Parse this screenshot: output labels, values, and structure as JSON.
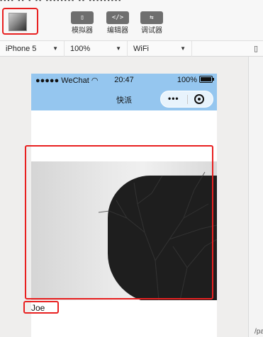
{
  "toolbar": {
    "tools": [
      {
        "label": "模拟器",
        "glyph": "▯"
      },
      {
        "label": "编辑器",
        "glyph": "</>"
      },
      {
        "label": "调试器",
        "glyph": "⇆"
      }
    ]
  },
  "device_bar": {
    "device": "iPhone 5",
    "zoom": "100%",
    "network": "WiFi"
  },
  "side_panel": {
    "path": "/pa"
  },
  "phone": {
    "status": {
      "carrier": "●●●●● WeChat",
      "time": "20:47",
      "battery": "100%"
    },
    "nav_title": "快派",
    "capsule_dots": "•••",
    "user_name": "Joe"
  },
  "colors": {
    "nav_bg": "#95c6ef",
    "highlight": "#e82020"
  },
  "icons": [
    "simulator-icon",
    "editor-icon",
    "debugger-icon",
    "wifi-icon",
    "battery-icon",
    "more-dots-icon",
    "close-target-icon"
  ]
}
